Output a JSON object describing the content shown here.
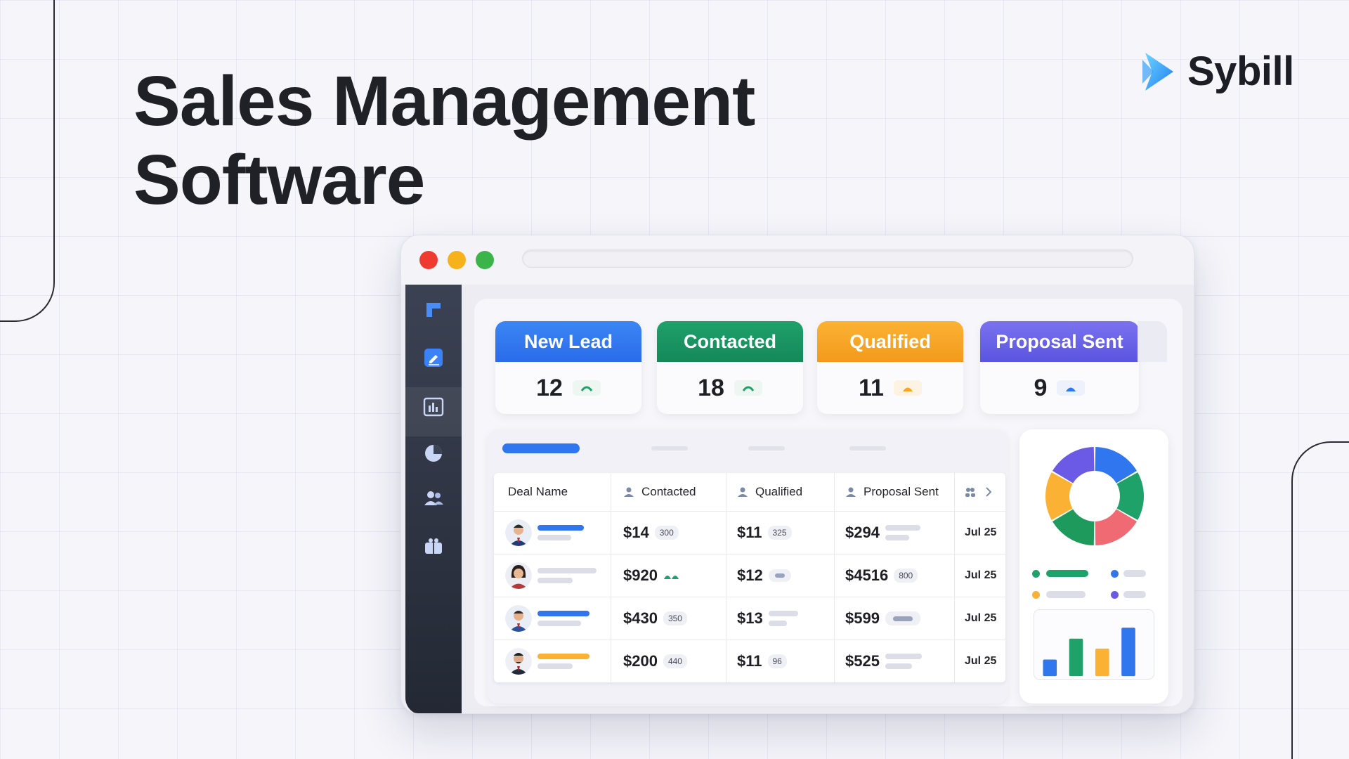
{
  "headline": {
    "line1": "Sales Management",
    "line2": "Software"
  },
  "brand": {
    "name": "Sybill",
    "accent": "#2aa7ff"
  },
  "window": {
    "controls": [
      "close",
      "minimize",
      "maximize"
    ]
  },
  "sidebar": {
    "items": [
      {
        "name": "logo-icon"
      },
      {
        "name": "edit-icon",
        "active": true
      },
      {
        "name": "report-icon"
      },
      {
        "name": "pie-chart-icon"
      },
      {
        "name": "team-icon"
      },
      {
        "name": "briefcase-icon"
      }
    ]
  },
  "stages": [
    {
      "label": "New Lead",
      "count": "12",
      "color": "#2a6bea"
    },
    {
      "label": "Contacted",
      "count": "18",
      "color": "#15885a"
    },
    {
      "label": "Qualified",
      "count": "11",
      "color": "#f39a1b"
    },
    {
      "label": "Proposal Sent",
      "count": "9",
      "color": "#5a55e0"
    }
  ],
  "table": {
    "headers": {
      "deal_name": "Deal Name",
      "contacted": "Contacted",
      "qualified": "Qualified",
      "proposal_sent": "Proposal Sent"
    },
    "rows": [
      {
        "contacted": "$14",
        "contacted_badge": "300",
        "qualified": "$11",
        "qualified_badge": "325",
        "proposal": "$294",
        "proposal_badge": "",
        "date": "Jul 25"
      },
      {
        "contacted": "$920",
        "contacted_badge": "",
        "qualified": "$12",
        "qualified_badge": "",
        "proposal": "$4516",
        "proposal_badge": "800",
        "date": "Jul 25"
      },
      {
        "contacted": "$430",
        "contacted_badge": "350",
        "qualified": "$13",
        "qualified_badge": "",
        "proposal": "$599",
        "proposal_badge": "",
        "date": "Jul 25"
      },
      {
        "contacted": "$200",
        "contacted_badge": "440",
        "qualified": "$11",
        "qualified_badge": "96",
        "proposal": "$525",
        "proposal_badge": "",
        "date": "Jul 25"
      }
    ]
  },
  "chart": {
    "donut_colors": [
      "#2f76ef",
      "#1fa16a",
      "#f06a74",
      "#1e9b5c",
      "#fbb234",
      "#6a5ae6"
    ],
    "bar_levels": [
      0.3,
      0.68,
      0.5,
      0.88
    ],
    "bar_colors": [
      "#2f76ef",
      "#1fa16a",
      "#fbb234",
      "#2f76ef"
    ]
  }
}
